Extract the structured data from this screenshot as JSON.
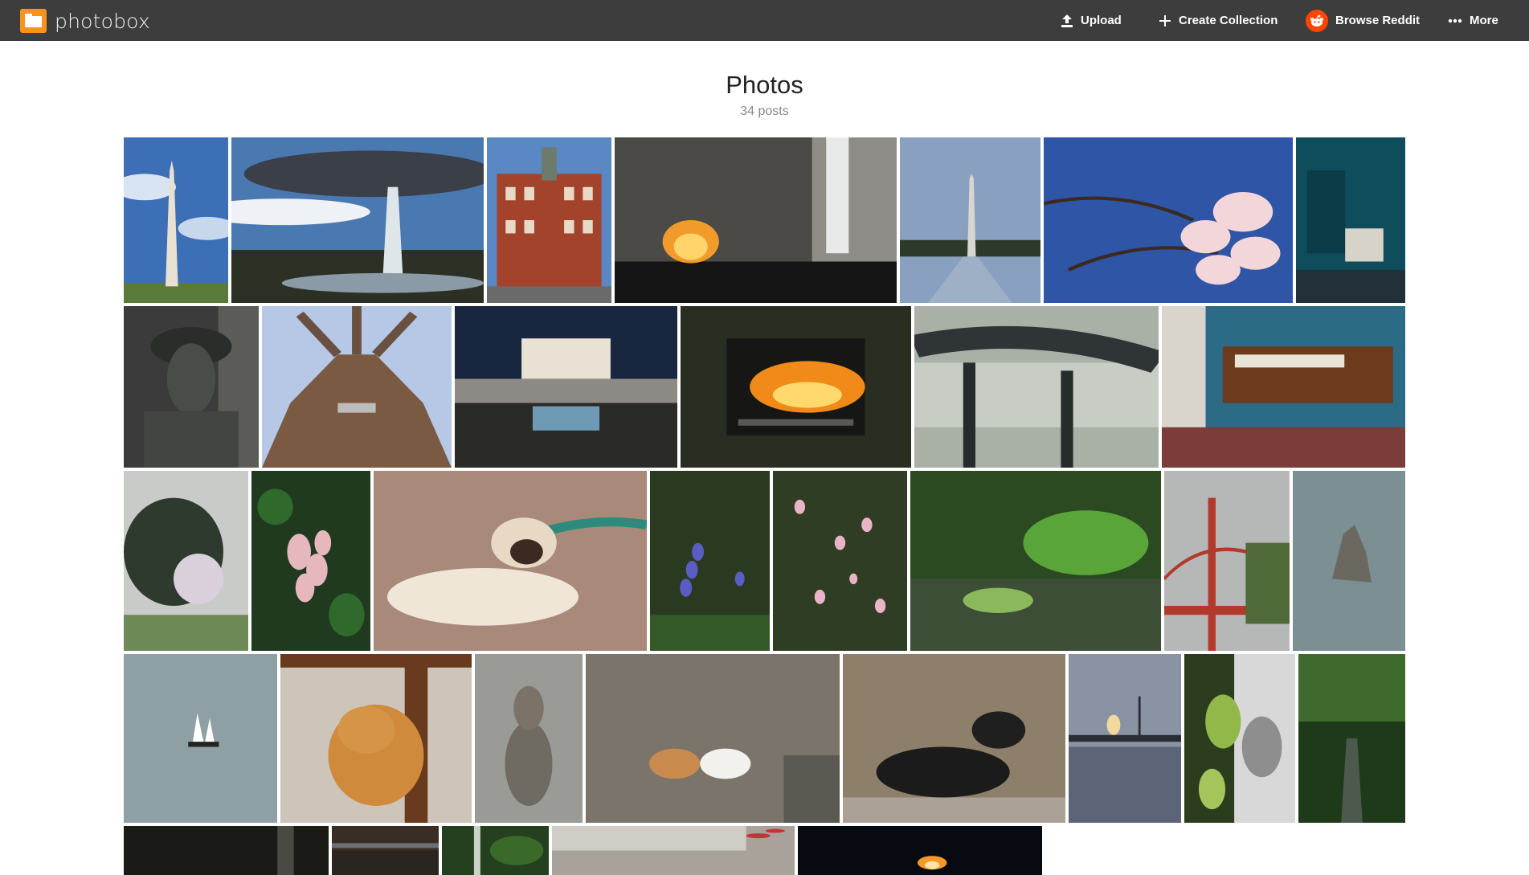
{
  "app": {
    "name": "photobox",
    "accent": "#f7931e",
    "topbar_bg": "#3d3d3d"
  },
  "nav": {
    "upload": {
      "label": "Upload",
      "icon": "upload-icon"
    },
    "create_collection": {
      "label": "Create Collection",
      "icon": "plus-icon"
    },
    "browse_reddit": {
      "label": "Browse Reddit",
      "icon": "reddit-icon",
      "color": "#ff4500"
    },
    "more": {
      "label": "More",
      "icon": "more-dots-icon"
    }
  },
  "page": {
    "title": "Photos",
    "count": "34 posts"
  },
  "photos": [
    {
      "subject": "washington-monument"
    },
    {
      "subject": "fountain"
    },
    {
      "subject": "brick-building"
    },
    {
      "subject": "fireplace-modern"
    },
    {
      "subject": "reflecting-pool-monument"
    },
    {
      "subject": "cherry-blossoms"
    },
    {
      "subject": "teal-room"
    },
    {
      "subject": "bronze-statue"
    },
    {
      "subject": "tree-trunk"
    },
    {
      "subject": "mansion-night"
    },
    {
      "subject": "fire-grill"
    },
    {
      "subject": "wet-railing"
    },
    {
      "subject": "piano-room"
    },
    {
      "subject": "cemetery-tree"
    },
    {
      "subject": "pink-flowers-cluster"
    },
    {
      "subject": "siamese-cat"
    },
    {
      "subject": "bluebells"
    },
    {
      "subject": "pink-flower-shrub"
    },
    {
      "subject": "japanese-garden-pond"
    },
    {
      "subject": "golden-gate-bridge"
    },
    {
      "subject": "sea-rock"
    },
    {
      "subject": "sailboat"
    },
    {
      "subject": "orange-cat"
    },
    {
      "subject": "tabby-cat"
    },
    {
      "subject": "two-kittens"
    },
    {
      "subject": "black-cat"
    },
    {
      "subject": "bridge-sunset"
    },
    {
      "subject": "green-fruit"
    },
    {
      "subject": "forest-stream"
    },
    {
      "subject": "dark-interior"
    },
    {
      "subject": "roof-eave"
    },
    {
      "subject": "mossy-waterfall"
    },
    {
      "subject": "window-ledge"
    },
    {
      "subject": "candle-flame"
    }
  ]
}
